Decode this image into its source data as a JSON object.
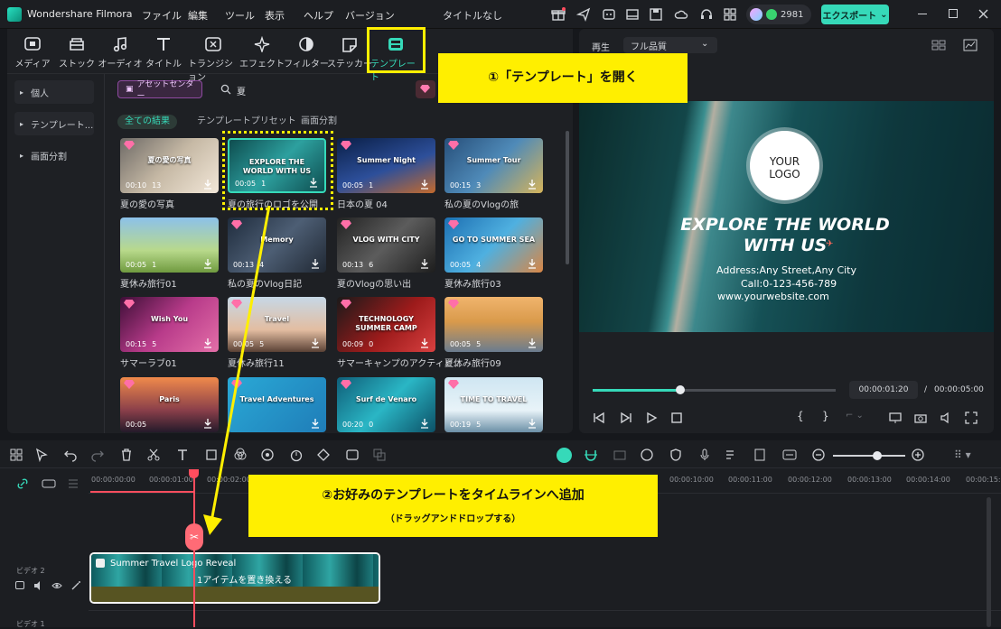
{
  "app": {
    "name": "Wondershare Filmora",
    "menu": [
      "ファイル",
      "編集",
      "ツール",
      "表示",
      "ヘルプ",
      "バージョン"
    ],
    "doc_title": "タイトルなし",
    "credits": "2981",
    "export_label": "エクスポート"
  },
  "toolbar": {
    "items": [
      "メディア",
      "ストック",
      "オーディオ",
      "タイトル",
      "トランジション",
      "エフェクト",
      "フィルター",
      "ステッカー",
      "テンプレート"
    ]
  },
  "sidebar": {
    "items": [
      "個人",
      "テンプレート...",
      "画面分割"
    ]
  },
  "search": {
    "asset_center": "アセットセンター",
    "query": "夏"
  },
  "filter_tabs": [
    "全ての結果",
    "テンプレートプリセット",
    "画面分割"
  ],
  "tiles": [
    {
      "label": "夏の愛の写真",
      "time": "00:10",
      "count": "13",
      "img": "夏の愛の写真"
    },
    {
      "label": "夏の旅行のロゴを公開",
      "time": "00:05",
      "count": "1",
      "img": "EXPLORE THE WORLD WITH US"
    },
    {
      "label": "日本の夏 04",
      "time": "00:05",
      "count": "1",
      "img": "Summer Night"
    },
    {
      "label": "私の夏のVlogの旅",
      "time": "00:15",
      "count": "3",
      "img": "Summer Tour"
    },
    {
      "label": "夏休み旅行01",
      "time": "00:05",
      "count": "1",
      "img": ""
    },
    {
      "label": "私の夏のVlog日記",
      "time": "00:13",
      "count": "4",
      "img": "Memory"
    },
    {
      "label": "夏のVlogの思い出",
      "time": "00:13",
      "count": "6",
      "img": "VLOG WITH CITY"
    },
    {
      "label": "夏休み旅行03",
      "time": "00:05",
      "count": "4",
      "img": "GO TO SUMMER SEA"
    },
    {
      "label": "サマーラブ01",
      "time": "00:15",
      "count": "5",
      "img": "Wish You"
    },
    {
      "label": "夏休み旅行11",
      "time": "00:05",
      "count": "5",
      "img": "Travel"
    },
    {
      "label": "サマーキャンプのアクティビ...",
      "time": "00:09",
      "count": "0",
      "img": "TECHNOLOGY SUMMER CAMP"
    },
    {
      "label": "夏休み旅行09",
      "time": "00:05",
      "count": "5",
      "img": ""
    },
    {
      "label": "",
      "time": "00:05",
      "count": "",
      "img": "Paris"
    },
    {
      "label": "",
      "time": "",
      "count": "",
      "img": "Travel Adventures"
    },
    {
      "label": "",
      "time": "00:20",
      "count": "0",
      "img": "Surf de Venaro"
    },
    {
      "label": "",
      "time": "00:19",
      "count": "5",
      "img": "TIME TO TRAVEL"
    }
  ],
  "preview": {
    "label": "再生",
    "quality": "フル品質",
    "logo_line1": "YOUR",
    "logo_line2": "LOGO",
    "headline1": "EXPLORE THE WORLD",
    "headline2": "WITH US",
    "address": "Address:Any Street,Any City",
    "call": "Call:0-123-456-789",
    "website": "www.yourwebsite.com",
    "current_time": "00:00:01:20",
    "separator": "/",
    "total_time": "00:00:05:00",
    "progress": 0.36
  },
  "timeline": {
    "ruler": [
      "00:00:00:00",
      "00:00:01:00",
      "00:00:02:00",
      "00:00:10:00",
      "00:00:11:00",
      "00:00:12:00",
      "00:00:13:00",
      "00:00:14:00",
      "00:00:15:00"
    ],
    "track2": "ビデオ 2",
    "track1": "ビデオ 1",
    "clip_title": "Summer Travel Logo Reveal",
    "clip_sub": "1アイテムを置き換える"
  },
  "annotations": {
    "step1": "①「テンプレート」を開く",
    "step2": "②お好みのテンプレートをタイムラインへ追加",
    "step2_sub": "（ドラッグアンドドロップする）"
  },
  "colors": {
    "accent": "#36d9b9",
    "annotation": "#ffef00",
    "playhead": "#ff4d5e"
  }
}
